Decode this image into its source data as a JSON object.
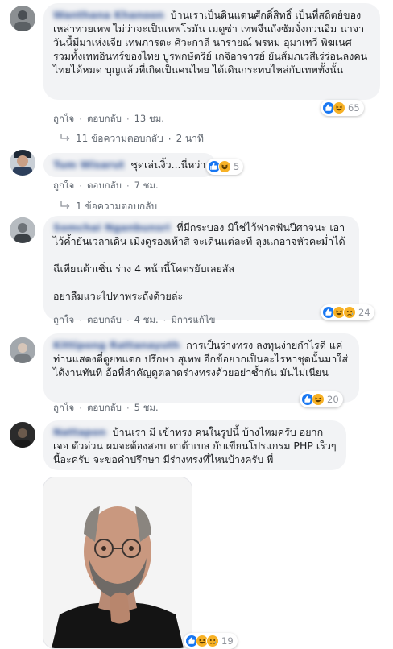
{
  "comments": [
    {
      "name": "Wanthana Khanoon",
      "lines": [
        "บ้านเราเป็นดินแดนศักดิ์สิทธิ์ เป็นที่สถิตย์ของเหล่าทวยเทพ ไม่ว่าจะเป็นเทพโรมัน เมดูซ่า เทพจีนถังซัมจั๋งกวนอิม นาจา วันนี้มีมาเห่งเจีย เทพภารตะ ศิวะกาลี นารายณ์ พรหม อุมาเทวี พิฆเนศ รวมทั้งเทพอินทร์ของไทย บูรพกษัตริย์ เกจิอาจารย์ ยันส์มภเวสีเร่ร่อนลงคนไทยได้หมด บุญแล้วที่เกิดเป็นคนไทย ได้เดินกระทบไหล่กับเทพทั้งนั้น"
      ],
      "actions": {
        "like": "ถูกใจ",
        "reply": "ตอบกลับ",
        "time": "13 ชม."
      },
      "reaction_count": "65",
      "replies_label": "11 ข้อความตอบกลับ",
      "replies_time": "2 นาที"
    },
    {
      "name": "Tum Wisarut",
      "lines": [
        "ชุดเล่นงิ้ว...นี่หว่า"
      ],
      "actions": {
        "like": "ถูกใจ",
        "reply": "ตอบกลับ",
        "time": "7 ชม."
      },
      "reaction_count": "5",
      "replies_label": "1 ข้อความตอบกลับ"
    },
    {
      "name": "Somchai Nganbunsri",
      "lines": [
        "ที่มีกระบอง มิใช่ไว้ฟาดฟันปีศาจนะ เอาไว้ค้ำยันเวลาเดิน เมิงดูรองเท้าสิ จะเดินแต่ละที ลุงแกอาจหัวคะม่ำได้",
        "ฉีเทียนต้าเซิ่น ร่าง 4 หน้านี้โคตรยับเลยสัส",
        "อย่าลืมแวะไปหาพระถังด้วยล่ะ"
      ],
      "actions": {
        "like": "ถูกใจ",
        "reply": "ตอบกลับ",
        "time": "4 ชม.",
        "edited": "มีการแก้ไข"
      },
      "reaction_count": "24"
    },
    {
      "name": "Kittipong Rattanayuth",
      "lines": [
        "การเป็นร่างทรง ลงทุนง่ายกำไรดี แค่ท่านแสดงตี๋ตูยทแดก ปรึกษา สุเทพ อีกข้อยากเป็นอะไรหาชุดนั้นมาใส่ ได้งานทันที อ้อที่สำคัญดูตลาดร่างทรงด้วยอย่าซ้ำกัน มันไม่เนียน"
      ],
      "actions": {
        "like": "ถูกใจ",
        "reply": "ตอบกลับ",
        "time": "5 ชม."
      },
      "reaction_count": "20"
    },
    {
      "name": "Nattapon",
      "lines": [
        "บ้านเรา มี เข้าทรง คนในรูปนี้ บ้างไหมครับ อยากเจอ ตัวด่วน ผมจะต้องสอบ ดาต้าเบส กับเขียนโปรแกรม PHP เร็วๆนี้อะครับ จะขอคำปรึกษา มีร่างทรงที่ไหนบ้างครับ พี่"
      ],
      "reaction_count": "19"
    }
  ],
  "icons": {
    "like": "like-icon",
    "haha": "haha-icon",
    "sad": "sad-icon",
    "reply_arrow": "reply-arrow-icon"
  },
  "colors": {
    "bubble": "#f2f3f5",
    "name": "#385898",
    "like_blue": "#1877f2",
    "haha_yellow": "#f7b125",
    "meta": "#606770"
  }
}
